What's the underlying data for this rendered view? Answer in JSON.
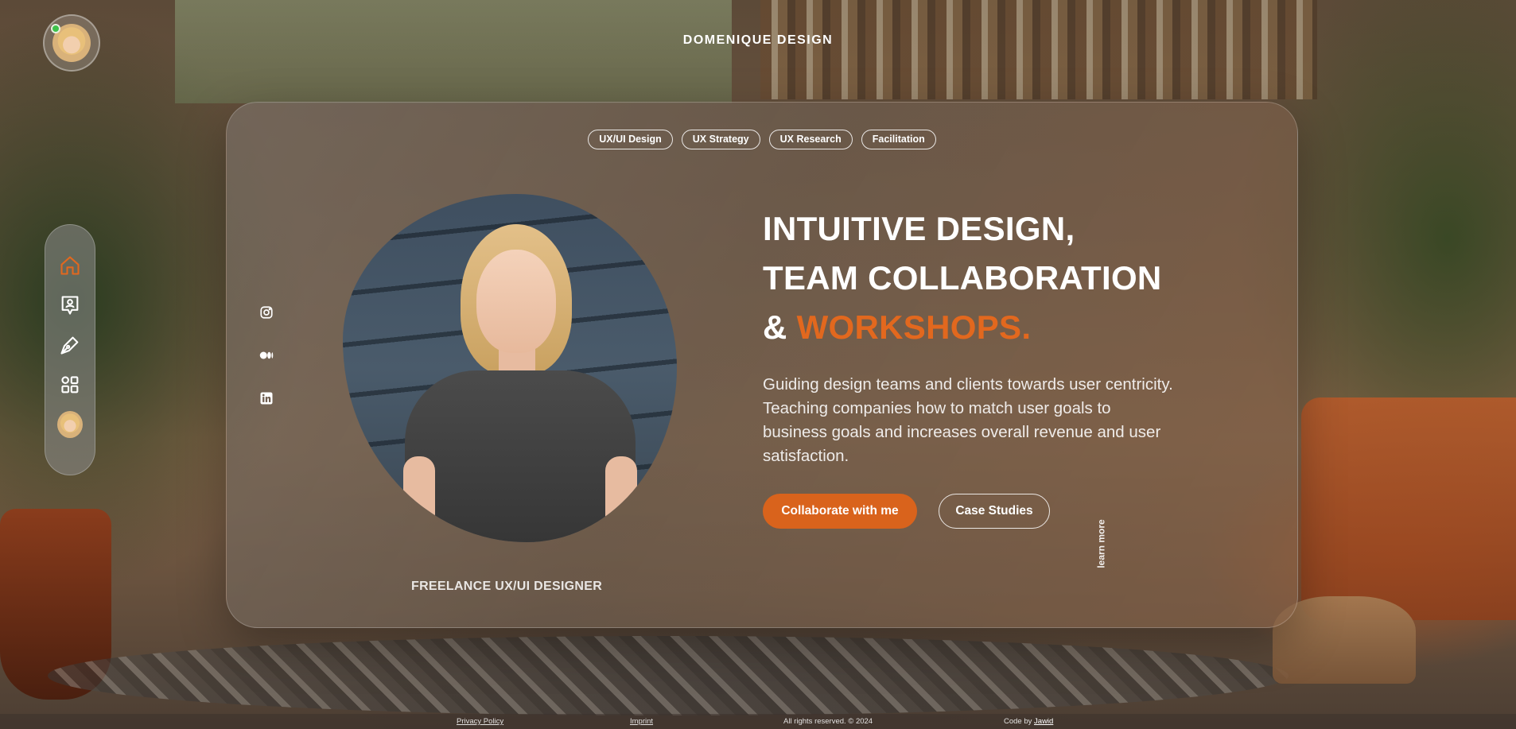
{
  "site": {
    "title": "DOMENIQUE DESIGN"
  },
  "colors": {
    "accent": "#e2681e",
    "button_primary": "#d9631c",
    "online": "#3ec24a"
  },
  "nav": {
    "items": [
      {
        "name": "home",
        "icon": "home-icon",
        "active": true
      },
      {
        "name": "about",
        "icon": "contact-icon",
        "active": false
      },
      {
        "name": "design",
        "icon": "pen-icon",
        "active": false
      },
      {
        "name": "portfolio",
        "icon": "grid-icon",
        "active": false
      },
      {
        "name": "profile",
        "icon": "avatar-icon",
        "active": false
      }
    ]
  },
  "tags": [
    "UX/UI Design",
    "UX Strategy",
    "UX Research",
    "Facilitation"
  ],
  "social": [
    "instagram-icon",
    "medium-icon",
    "linkedin-icon"
  ],
  "hero": {
    "headline_line1": "INTUITIVE DESIGN,",
    "headline_line2": "TEAM COLLABORATION",
    "headline_prefix": "& ",
    "headline_accent": "WORKSHOPS.",
    "lead": "Guiding design teams and clients towards user centricity. Teaching companies how to match user goals to business goals and increases overall revenue and user satisfaction.",
    "primary_button": "Collaborate with me",
    "secondary_button": "Case Studies",
    "learn_more": "learn more",
    "role": "FREELANCE UX/UI DESIGNER"
  },
  "footer": {
    "privacy": "Privacy Policy",
    "imprint": "Imprint",
    "rights": "All rights reserved. © 2024",
    "code_by_prefix": "Code by",
    "code_by_name": "Jawid"
  }
}
